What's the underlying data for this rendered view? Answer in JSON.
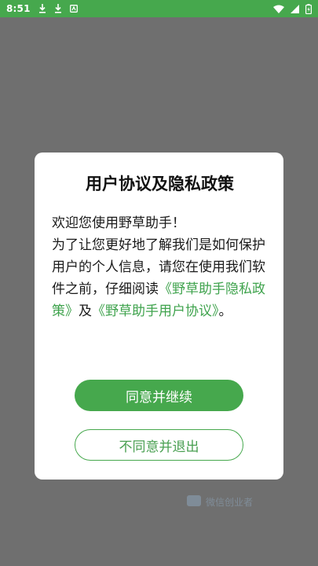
{
  "status_bar": {
    "time": "8:51",
    "left_icons": [
      "download-icon",
      "download-icon",
      "notification-icon"
    ],
    "right_icons": [
      "wifi-icon",
      "signal-icon",
      "battery-icon"
    ],
    "background": "#46a84d"
  },
  "dialog": {
    "title": "用户协议及隐私政策",
    "greeting": "欢迎您使用野草助手！",
    "body_prefix": "为了让您更好地了解我们是如何保护用户的个人信息，请您在使用我们软件之前，仔细阅读",
    "privacy_link": "《野草助手隐私政策》",
    "conjunction": "及",
    "agreement_link": "《野草助手用户协议》",
    "body_suffix": "。",
    "agree_button": "同意并继续",
    "disagree_button": "不同意并退出",
    "accent_color": "#46a84d"
  },
  "watermark": {
    "text": "微信创业者"
  }
}
